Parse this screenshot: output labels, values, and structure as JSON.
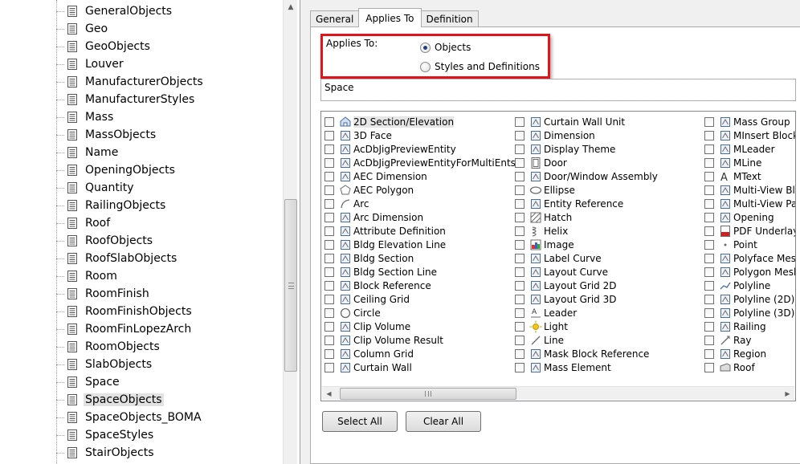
{
  "tree": {
    "items": [
      {
        "label": "GeneralObjects"
      },
      {
        "label": "Geo"
      },
      {
        "label": "GeoObjects"
      },
      {
        "label": "Louver"
      },
      {
        "label": "ManufacturerObjects"
      },
      {
        "label": "ManufacturerStyles"
      },
      {
        "label": "Mass"
      },
      {
        "label": "MassObjects"
      },
      {
        "label": "Name"
      },
      {
        "label": "OpeningObjects"
      },
      {
        "label": "Quantity"
      },
      {
        "label": "RailingObjects"
      },
      {
        "label": "Roof"
      },
      {
        "label": "RoofObjects"
      },
      {
        "label": "RoofSlabObjects"
      },
      {
        "label": "Room"
      },
      {
        "label": "RoomFinish"
      },
      {
        "label": "RoomFinishObjects"
      },
      {
        "label": "RoomFinLopezArch"
      },
      {
        "label": "RoomObjects"
      },
      {
        "label": "SlabObjects"
      },
      {
        "label": "Space"
      },
      {
        "label": "SpaceObjects",
        "selected": true
      },
      {
        "label": "SpaceObjects_BOMA"
      },
      {
        "label": "SpaceStyles"
      },
      {
        "label": "StairObjects"
      }
    ]
  },
  "tabs": [
    {
      "label": "General",
      "active": false
    },
    {
      "label": "Applies To",
      "active": true
    },
    {
      "label": "Definition",
      "active": false
    }
  ],
  "applies_to": {
    "label": "Applies To:",
    "options": [
      {
        "label": "Objects",
        "checked": true
      },
      {
        "label": "Styles and Definitions",
        "checked": false
      }
    ]
  },
  "filter_value": "Space",
  "object_list": {
    "columns": [
      [
        {
          "label": "2D Section/Elevation",
          "icon": "section-elevation-icon",
          "highlight": true
        },
        {
          "label": "3D Face",
          "icon": "3d-face-icon"
        },
        {
          "label": "AcDbJigPreviewEntity",
          "icon": "generic-entity-icon"
        },
        {
          "label": "AcDbJigPreviewEntityForMultiEnts",
          "icon": "generic-entity-icon"
        },
        {
          "label": "AEC Dimension",
          "icon": "aec-dimension-icon"
        },
        {
          "label": "AEC Polygon",
          "icon": "polygon-icon"
        },
        {
          "label": "Arc",
          "icon": "arc-icon"
        },
        {
          "label": "Arc Dimension",
          "icon": "arc-dimension-icon"
        },
        {
          "label": "Attribute Definition",
          "icon": "attribute-icon"
        },
        {
          "label": "Bldg Elevation Line",
          "icon": "elevation-line-icon"
        },
        {
          "label": "Bldg Section",
          "icon": "bldg-section-icon"
        },
        {
          "label": "Bldg Section Line",
          "icon": "section-line-icon"
        },
        {
          "label": "Block Reference",
          "icon": "block-icon"
        },
        {
          "label": "Ceiling Grid",
          "icon": "ceiling-grid-icon"
        },
        {
          "label": "Circle",
          "icon": "circle-icon"
        },
        {
          "label": "Clip Volume",
          "icon": "clip-volume-icon"
        },
        {
          "label": "Clip Volume Result",
          "icon": "clip-volume-result-icon"
        },
        {
          "label": "Column Grid",
          "icon": "column-grid-icon"
        },
        {
          "label": "Curtain Wall",
          "icon": "curtain-wall-icon"
        }
      ],
      [
        {
          "label": "Curtain Wall Unit",
          "icon": "curtain-wall-unit-icon"
        },
        {
          "label": "Dimension",
          "icon": "dimension-icon"
        },
        {
          "label": "Display Theme",
          "icon": "display-theme-icon"
        },
        {
          "label": "Door",
          "icon": "door-icon"
        },
        {
          "label": "Door/Window Assembly",
          "icon": "door-window-assembly-icon"
        },
        {
          "label": "Ellipse",
          "icon": "ellipse-icon"
        },
        {
          "label": "Entity Reference",
          "icon": "entity-reference-icon"
        },
        {
          "label": "Hatch",
          "icon": "hatch-icon"
        },
        {
          "label": "Helix",
          "icon": "helix-icon"
        },
        {
          "label": "Image",
          "icon": "image-icon"
        },
        {
          "label": "Label Curve",
          "icon": "label-curve-icon"
        },
        {
          "label": "Layout Curve",
          "icon": "layout-curve-icon"
        },
        {
          "label": "Layout Grid 2D",
          "icon": "layout-grid-2d-icon"
        },
        {
          "label": "Layout Grid 3D",
          "icon": "layout-grid-3d-icon"
        },
        {
          "label": "Leader",
          "icon": "leader-icon"
        },
        {
          "label": "Light",
          "icon": "light-icon"
        },
        {
          "label": "Line",
          "icon": "line-icon"
        },
        {
          "label": "Mask Block Reference",
          "icon": "mask-block-icon"
        },
        {
          "label": "Mass Element",
          "icon": "mass-element-icon"
        }
      ],
      [
        {
          "label": "Mass Group",
          "icon": "mass-group-icon"
        },
        {
          "label": "MInsert Block",
          "icon": "minsert-block-icon"
        },
        {
          "label": "MLeader",
          "icon": "mleader-icon"
        },
        {
          "label": "MLine",
          "icon": "mline-icon"
        },
        {
          "label": "MText",
          "icon": "mtext-icon"
        },
        {
          "label": "Multi-View Blo",
          "icon": "multi-view-block-icon"
        },
        {
          "label": "Multi-View Pa",
          "icon": "multi-view-part-icon"
        },
        {
          "label": "Opening",
          "icon": "opening-icon"
        },
        {
          "label": "PDF Underlay",
          "icon": "pdf-underlay-icon"
        },
        {
          "label": "Point",
          "icon": "point-icon"
        },
        {
          "label": "Polyface Mesh",
          "icon": "polyface-mesh-icon"
        },
        {
          "label": "Polygon Mesh",
          "icon": "polygon-mesh-icon"
        },
        {
          "label": "Polyline",
          "icon": "polyline-icon"
        },
        {
          "label": "Polyline (2D)",
          "icon": "polyline-2d-icon"
        },
        {
          "label": "Polyline (3D)",
          "icon": "polyline-3d-icon"
        },
        {
          "label": "Railing",
          "icon": "railing-icon"
        },
        {
          "label": "Ray",
          "icon": "ray-icon"
        },
        {
          "label": "Region",
          "icon": "region-icon"
        },
        {
          "label": "Roof",
          "icon": "roof-icon"
        }
      ]
    ]
  },
  "buttons": {
    "select_all": "Select All",
    "clear_all": "Clear All"
  },
  "colors": {
    "highlight_border": "#e0141a",
    "radio_dot": "#1f3f7a"
  }
}
